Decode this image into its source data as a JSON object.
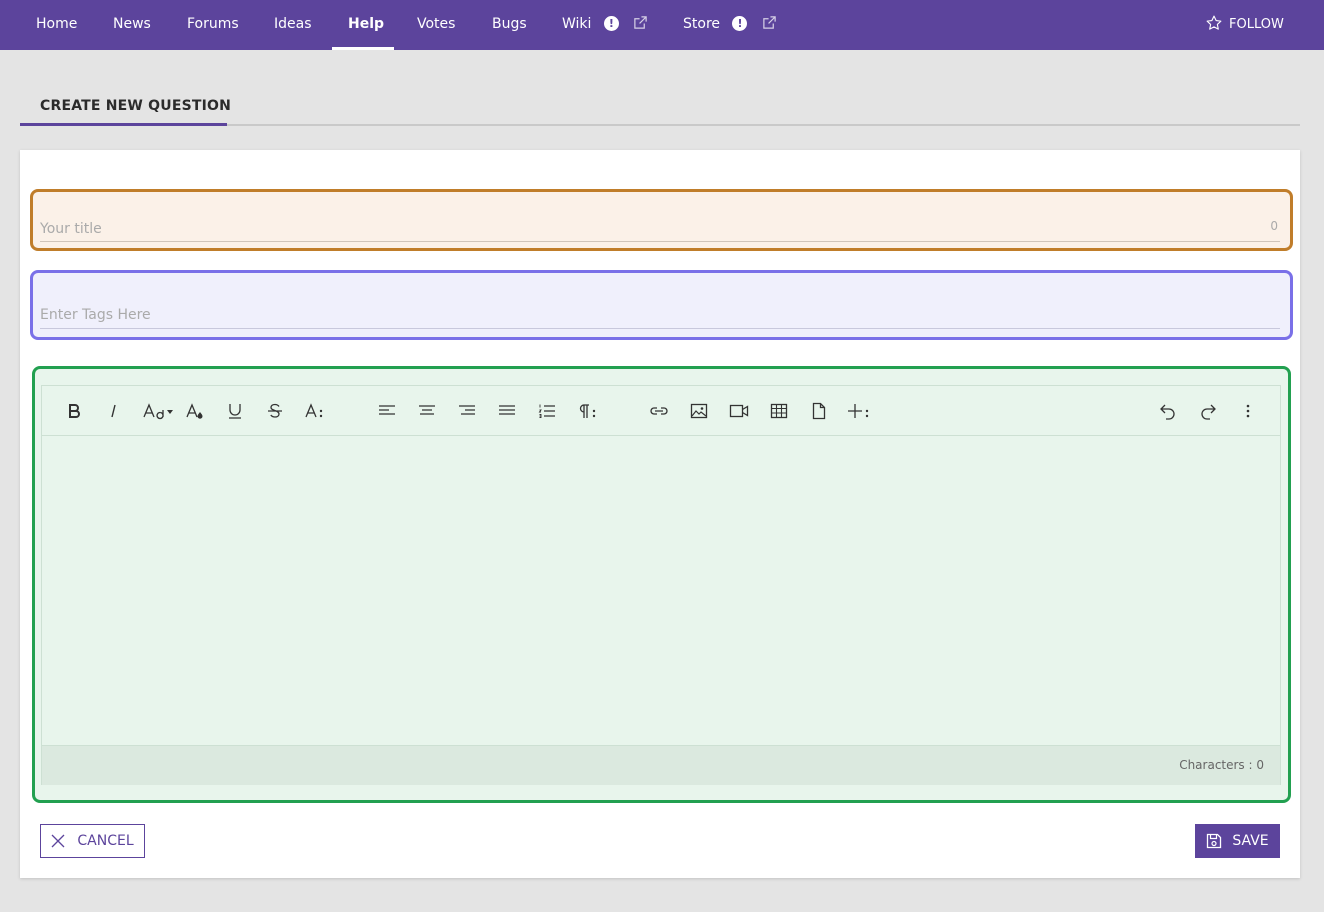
{
  "nav": {
    "items": [
      "Home",
      "News",
      "Forums",
      "Ideas",
      "Help",
      "Votes",
      "Bugs",
      "Wiki",
      "Store"
    ],
    "active": "Help",
    "follow_label": "FOLLOW",
    "alert_glyph": "!"
  },
  "page": {
    "tab_label": "CREATE NEW QUESTION"
  },
  "form": {
    "title_placeholder": "Your title",
    "title_count": "0",
    "tags_placeholder": "Enter Tags Here",
    "characters_label": "Characters : 0"
  },
  "toolbar": {
    "icons": [
      "bold-icon",
      "italic-icon",
      "font-size-icon",
      "text-color-icon",
      "underline-icon",
      "strikethrough-icon",
      "more-text-icon",
      "align-left-icon",
      "align-center-icon",
      "align-right-icon",
      "align-justify-icon",
      "ordered-list-icon",
      "more-paragraph-icon",
      "link-icon",
      "image-icon",
      "video-icon",
      "table-icon",
      "file-icon",
      "more-insert-icon",
      "undo-icon",
      "redo-icon",
      "more-menu-icon"
    ]
  },
  "actions": {
    "cancel_label": "CANCEL",
    "save_label": "SAVE"
  },
  "colors": {
    "brand": "#5c449c",
    "title_border": "#c07d2a",
    "tags_border": "#7a70e8",
    "editor_border": "#22a050"
  }
}
